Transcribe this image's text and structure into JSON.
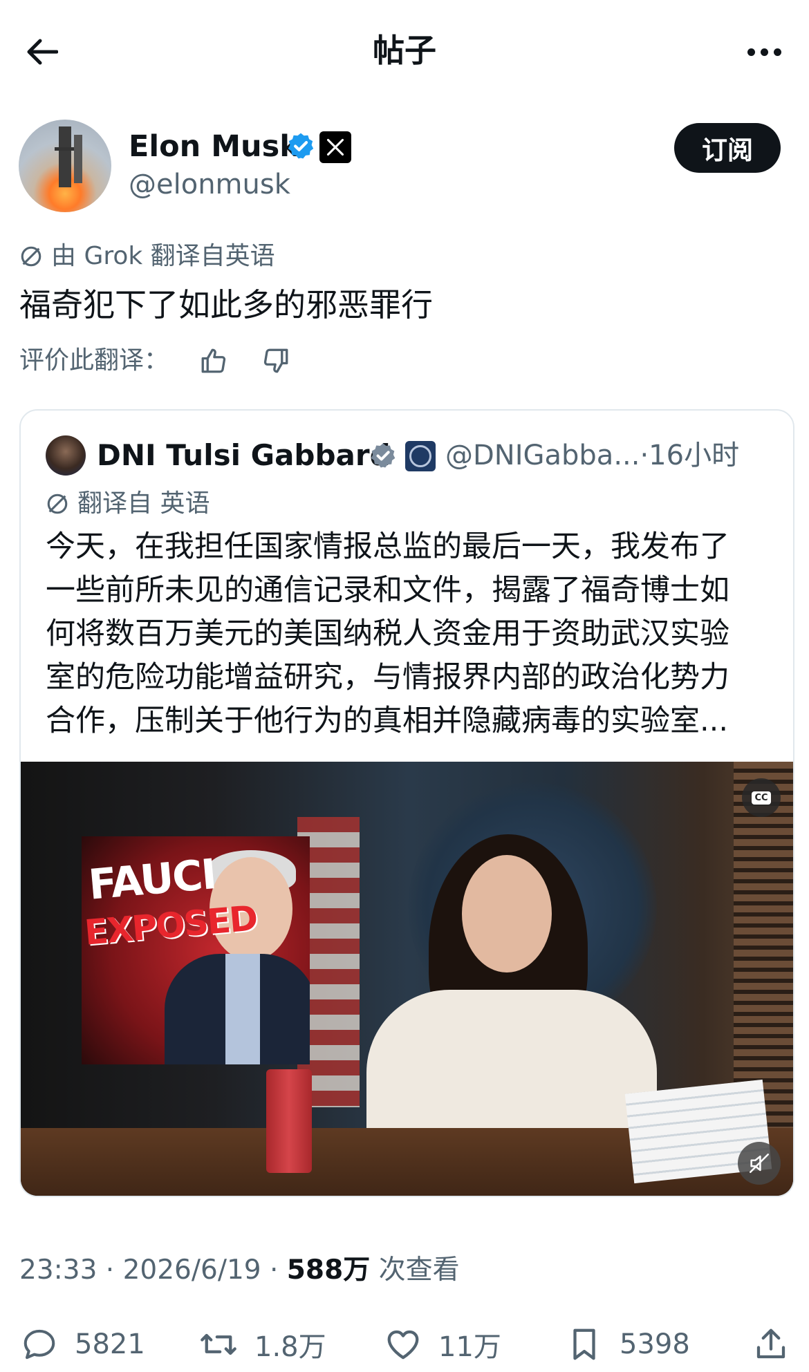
{
  "header": {
    "title": "帖子"
  },
  "author": {
    "name": "Elon Musk",
    "handle": "@elonmusk"
  },
  "subscribe_label": "订阅",
  "translation": {
    "note": "由 Grok 翻译自英语",
    "rate_label": "评价此翻译："
  },
  "tweet": {
    "text": "福奇犯下了如此多的邪恶罪行"
  },
  "quote": {
    "name": "DNI Tulsi Gabbard",
    "handle": "@DNIGabba...",
    "time": "·16小时",
    "translate_note": "翻译自 英语",
    "lines": [
      "今天，在我担任国家情报总监的最后一天，我发布了",
      "一些前所未见的通信记录和文件，揭露了福奇博士如",
      "何将数百万美元的美国纳税人资金用于资助武汉实验",
      "室的危险功能增益研究，与情报界内部的政治化势力",
      "合作，压制关于他行为的真相并隐藏病毒的实验室..."
    ],
    "video": {
      "thumbnail_text_1": "FAUCI",
      "thumbnail_text_2": "EXPOSED",
      "cc_label": "CC"
    }
  },
  "meta": {
    "time": "23:33",
    "sep1": " · ",
    "date": "2026/6/19",
    "sep2": " · ",
    "views": "588万",
    "views_label": " 次查看"
  },
  "actions": {
    "replies": "5821",
    "reposts": "1.8万",
    "likes": "11万",
    "bookmarks": "5398"
  },
  "colors": {
    "text": "#0f1419",
    "secondary": "#536471",
    "verified": "#1d9bf0",
    "border": "#e1e8ed"
  },
  "icons": [
    "back-arrow-icon",
    "more-icon",
    "verified-icon",
    "x-logo-icon",
    "translate-icon",
    "thumbs-up-icon",
    "thumbs-down-icon",
    "cc-icon",
    "mute-icon",
    "reply-icon",
    "repost-icon",
    "like-icon",
    "bookmark-icon",
    "share-icon"
  ]
}
